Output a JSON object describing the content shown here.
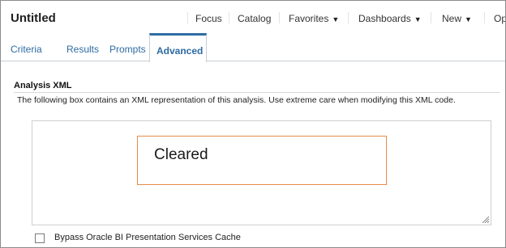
{
  "header": {
    "title": "Untitled",
    "nav": [
      {
        "label": "Focus",
        "caret": ""
      },
      {
        "label": "Catalog",
        "caret": ""
      },
      {
        "label": "Favorites",
        "caret": "▼"
      },
      {
        "label": "Dashboards",
        "caret": "▼"
      },
      {
        "label": "New",
        "caret": "▼"
      },
      {
        "label": "Op",
        "caret": ""
      }
    ]
  },
  "tabs": {
    "items": [
      "Criteria",
      "Results",
      "Prompts",
      "Advanced"
    ],
    "active": "Advanced"
  },
  "analysis_xml": {
    "title": "Analysis XML",
    "description": "The following box contains an XML representation of this analysis. Use extreme care when modifying this XML code.",
    "value": ""
  },
  "overlay": {
    "text": "Cleared",
    "border_color": "#e88b4a"
  },
  "bypass_cache": {
    "label": "Bypass Oracle BI Presentation Services Cache",
    "checked": false
  },
  "colors": {
    "link": "#2d6aa3",
    "tab_accent": "#2e6da4"
  }
}
